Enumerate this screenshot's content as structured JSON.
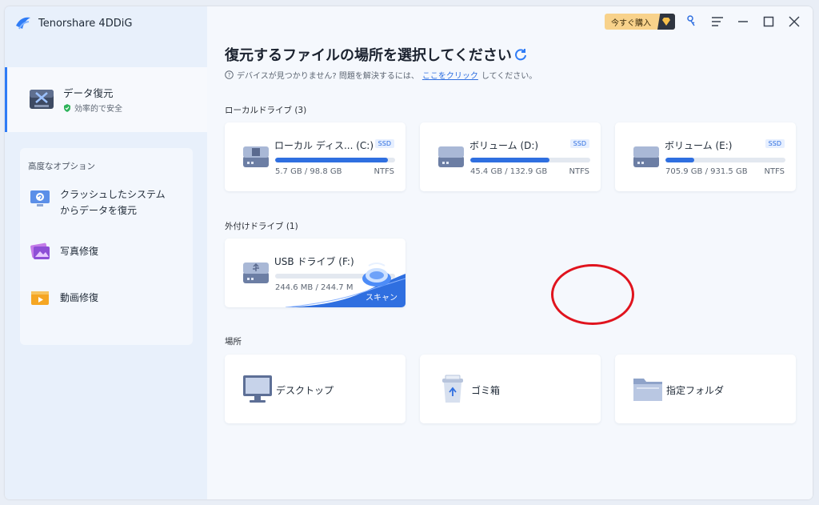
{
  "app": {
    "title": "Tenorshare 4DDiG"
  },
  "sidebar": {
    "active": {
      "title": "データ復元",
      "subtitle": "効率的で安全"
    },
    "advanced_header": "高度なオプション",
    "items": [
      {
        "label_line1": "クラッシュしたシステム",
        "label_line2": "からデータを復元"
      },
      {
        "label_line1": "写真修復"
      },
      {
        "label_line1": "動画修復"
      }
    ]
  },
  "topbar": {
    "buy_label": "今すぐ購入"
  },
  "main": {
    "title": "復元するファイルの場所を選択してください",
    "help_prefix": "デバイスが見つかりません? 問題を解決するには、",
    "help_link": "ここをクリック",
    "help_suffix": "してください。"
  },
  "local_drives": {
    "header": "ローカルドライブ (3)",
    "drives": [
      {
        "name": "ローカル ディス... (C:)",
        "badge": "SSD",
        "usage": "5.7 GB / 98.8 GB",
        "fs": "NTFS",
        "fill_fraction": 0.94
      },
      {
        "name": "ボリューム (D:)",
        "badge": "SSD",
        "usage": "45.4 GB / 132.9 GB",
        "fs": "NTFS",
        "fill_fraction": 0.66
      },
      {
        "name": "ボリューム (E:)",
        "badge": "SSD",
        "usage": "705.9 GB / 931.5 GB",
        "fs": "NTFS",
        "fill_fraction": 0.24
      }
    ]
  },
  "external_drives": {
    "header": "外付けドライブ (1)",
    "drives": [
      {
        "name": "USB ドライブ (F:)",
        "usage": "244.6 MB / 244.7 M",
        "scan_label": "スキャン"
      }
    ]
  },
  "locations": {
    "header": "場所",
    "items": [
      {
        "label": "デスクトップ"
      },
      {
        "label": "ゴミ箱"
      },
      {
        "label": "指定フォルダ"
      }
    ]
  },
  "colors": {
    "accent": "#2f6fe0",
    "highlight_circle": "#e0141e",
    "buy_bg": "#f8d28b"
  }
}
